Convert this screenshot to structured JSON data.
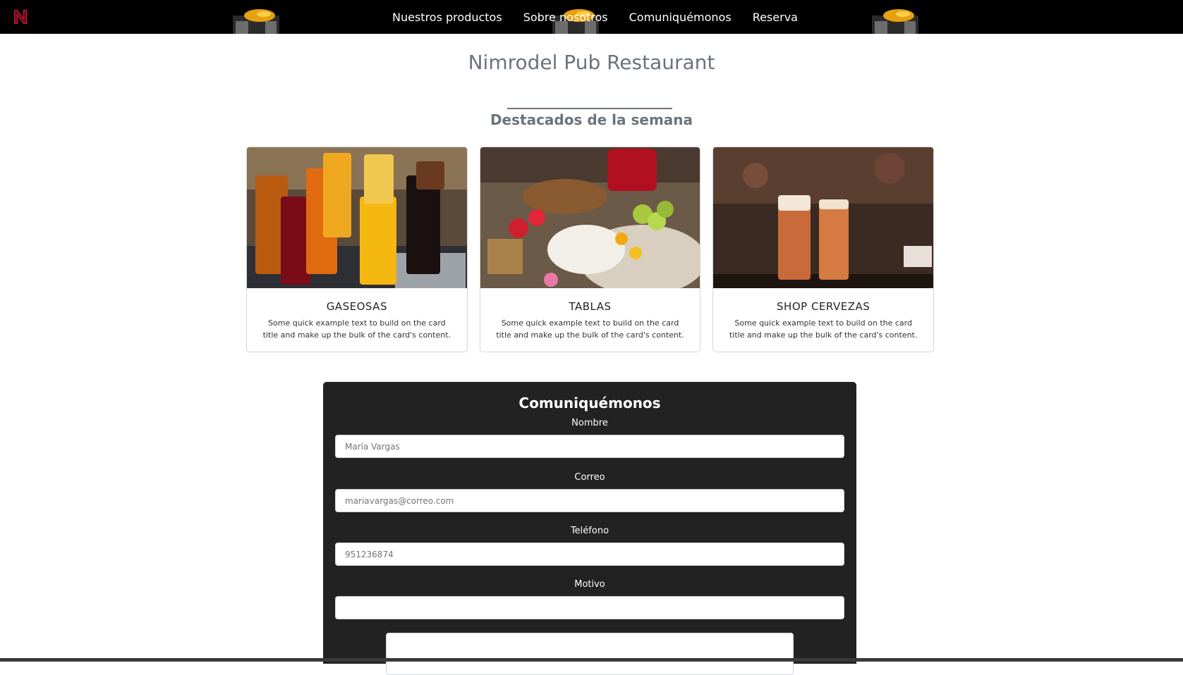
{
  "colors": {
    "navbar_bg": "#000000",
    "heading_gray": "#6c737a",
    "form_bg": "#222222",
    "logo_red": "#e0153c"
  },
  "logo": {
    "letter": "N",
    "icon": "brand-n-icon"
  },
  "nav": {
    "items": [
      {
        "label": "Nuestros productos"
      },
      {
        "label": "Sobre nosotros"
      },
      {
        "label": "Comuniquémonos"
      },
      {
        "label": "Reserva"
      }
    ],
    "decor_icon": "drink-glass-icon"
  },
  "page": {
    "title": "Nimrodel Pub Restaurant",
    "section_title": "Destacados de la semana"
  },
  "cards": [
    {
      "title": "GASEOSAS",
      "text": "Some quick example text to build on the card title and make up the bulk of the card's content.",
      "image": "soft-drinks-photo"
    },
    {
      "title": "TABLAS",
      "text": "Some quick example text to build on the card title and make up the bulk of the card's content.",
      "image": "cheese-board-photo"
    },
    {
      "title": "SHOP CERVEZAS",
      "text": "Some quick example text to build on the card title and make up the bulk of the card's content.",
      "image": "beer-glasses-photo"
    }
  ],
  "contact": {
    "title": "Comuniquémonos",
    "fields": [
      {
        "label": "Nombre",
        "placeholder": "María Vargas"
      },
      {
        "label": "Correo",
        "placeholder": "mariavargas@correo.com"
      },
      {
        "label": "Teléfono",
        "placeholder": "951236874"
      },
      {
        "label": "Motivo",
        "placeholder": ""
      }
    ]
  }
}
